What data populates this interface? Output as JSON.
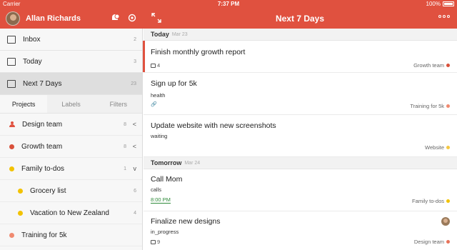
{
  "status_bar": {
    "carrier": "Carrier",
    "time": "7:37 PM",
    "battery": "100%"
  },
  "header": {
    "user_name": "Allan Richards",
    "view_title": "Next 7 Days"
  },
  "sidebar": {
    "nav": [
      {
        "label": "Inbox",
        "count": "2"
      },
      {
        "label": "Today",
        "count": "3"
      },
      {
        "label": "Next 7 Days",
        "count": "23"
      }
    ],
    "tabs": [
      "Projects",
      "Labels",
      "Filters"
    ],
    "projects": [
      {
        "label": "Design team",
        "count": "8",
        "color": "#e8735a",
        "icon": "person-icon",
        "chevron": "<"
      },
      {
        "label": "Growth team",
        "count": "8",
        "color": "#d9503a",
        "chevron": "<"
      },
      {
        "label": "Family to-dos",
        "count": "1",
        "color": "#f2c200",
        "chevron": "v"
      },
      {
        "label": "Grocery list",
        "count": "6",
        "color": "#f2c200"
      },
      {
        "label": "Vacation to New Zealand",
        "count": "4",
        "color": "#f2c200"
      },
      {
        "label": "Training for 5k",
        "count": "",
        "color": "#f08a70"
      }
    ]
  },
  "main": {
    "sections": [
      {
        "title": "Today",
        "date": "Mar 23"
      },
      {
        "title": "Tomorrow",
        "date": "Mar 24"
      }
    ],
    "tasks": [
      {
        "title": "Finish monthly growth report",
        "comments": "4",
        "project": "Growth team",
        "color": "#d9503a"
      },
      {
        "title": "Sign up for 5k",
        "note": "health",
        "project": "Training for 5k",
        "color": "#f08a70"
      },
      {
        "title": "Update website with new screenshots",
        "note": "waiting",
        "project": "Website",
        "color": "#f5c842"
      },
      {
        "title": "Call Mom",
        "note": "calls",
        "time": "8:00 PM",
        "project": "Family to-dos",
        "color": "#f2c200"
      },
      {
        "title": "Finalize new designs",
        "note": "in_progress",
        "comments": "9",
        "project": "Design team",
        "color": "#e8735a"
      }
    ]
  }
}
